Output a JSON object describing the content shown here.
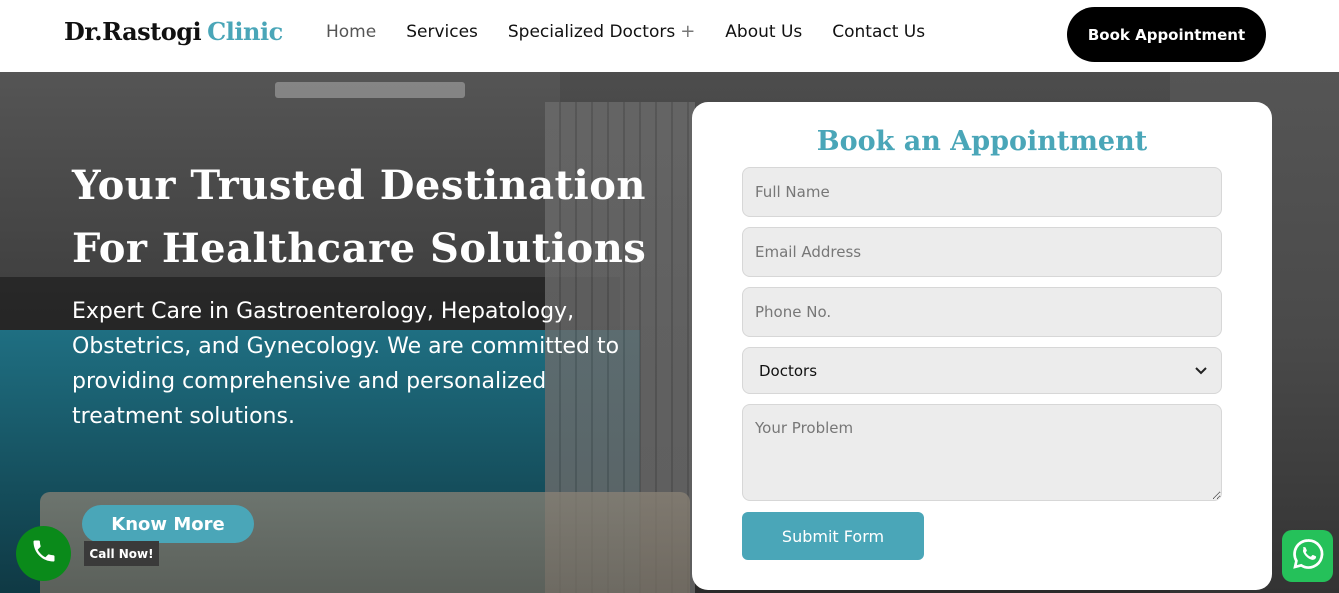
{
  "header": {
    "logo": {
      "part1": "Dr.Rastogi",
      "part2": "Clinic"
    },
    "nav": [
      {
        "label": "Home",
        "active": true
      },
      {
        "label": "Services"
      },
      {
        "label": "Specialized Doctors",
        "icon": "plus-icon"
      },
      {
        "label": "About Us"
      },
      {
        "label": "Contact Us"
      }
    ],
    "cta_label": "Book Appointment"
  },
  "hero": {
    "title": "Your Trusted Destination For Healthcare Solutions",
    "subtitle": "Expert Care in Gastroenterology, Hepatology, Obstetrics, and Gynecology. We are committed to providing comprehensive and personalized treatment solutions.",
    "button_label": "Know More"
  },
  "form": {
    "title": "Book an Appointment",
    "name_placeholder": "Full Name",
    "email_placeholder": "Email Address",
    "phone_placeholder": "Phone No.",
    "doctor_select": "Doctors",
    "problem_placeholder": "Your Problem",
    "submit_label": "Submit Form"
  },
  "widgets": {
    "call_label": "Call Now!",
    "call_icon": "phone-icon",
    "whatsapp_icon": "whatsapp-icon"
  },
  "colors": {
    "accent": "#4aa6b8",
    "cta_bg": "#000000",
    "call_green": "#0a8a1a",
    "whatsapp_green": "#25c15a"
  }
}
